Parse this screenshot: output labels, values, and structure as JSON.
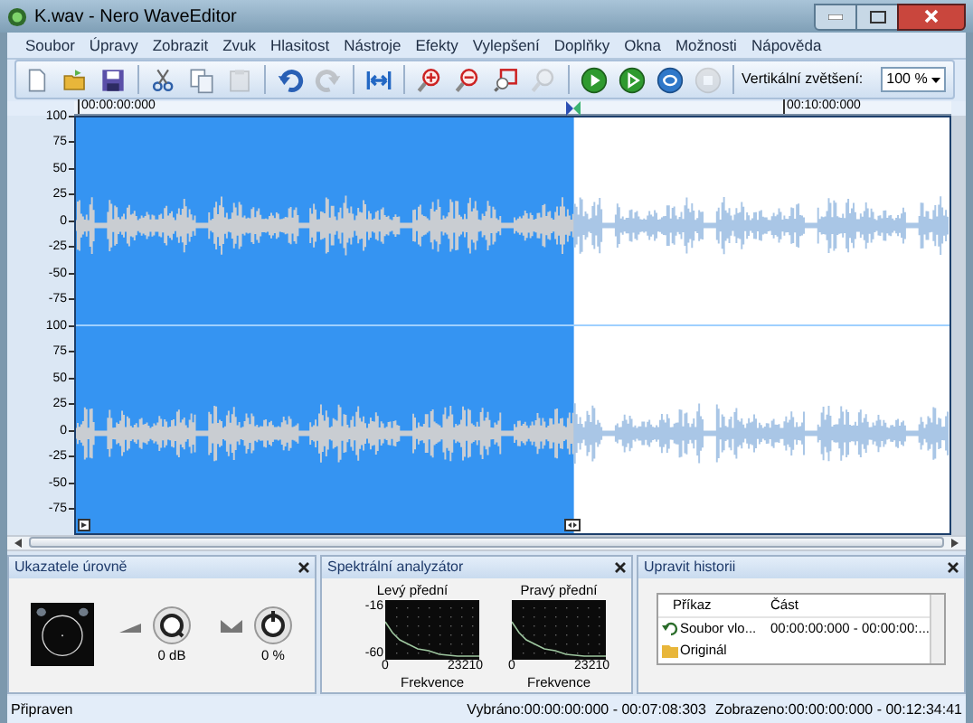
{
  "window": {
    "title": "K.wav - Nero WaveEditor"
  },
  "menu": [
    "Soubor",
    "Úpravy",
    "Zobrazit",
    "Zvuk",
    "Hlasitost",
    "Nástroje",
    "Efekty",
    "Vylepšení",
    "Doplňky",
    "Okna",
    "Možnosti",
    "Nápověda"
  ],
  "toolbar": {
    "groups": [
      [
        {
          "kind": "new",
          "disabled": false
        },
        {
          "kind": "open",
          "disabled": false
        },
        {
          "kind": "save",
          "disabled": false
        }
      ],
      [
        {
          "kind": "cut",
          "disabled": false
        },
        {
          "kind": "copy",
          "disabled": false
        },
        {
          "kind": "paste",
          "disabled": true
        }
      ],
      [
        {
          "kind": "undo",
          "disabled": false
        },
        {
          "kind": "redo",
          "disabled": true
        }
      ],
      [
        {
          "kind": "fit",
          "disabled": false
        }
      ],
      [
        {
          "kind": "zoom-in",
          "disabled": false
        },
        {
          "kind": "zoom-out",
          "disabled": false
        },
        {
          "kind": "zoom-selection",
          "disabled": false
        },
        {
          "kind": "zoom-reset",
          "disabled": true
        }
      ],
      [
        {
          "kind": "play",
          "disabled": false
        },
        {
          "kind": "play-selection",
          "disabled": false
        },
        {
          "kind": "loop",
          "disabled": false
        },
        {
          "kind": "stop",
          "disabled": true
        }
      ]
    ],
    "zoom_label": "Vertikální zvětšení:",
    "zoom_value": "100 %"
  },
  "ruler": {
    "start": "00:00:00:000",
    "mark": "00:10:00:000"
  },
  "channels": [
    {
      "axis_labels": [
        "100",
        "75",
        "50",
        "25",
        "0",
        "-25",
        "-50",
        "-75"
      ]
    },
    {
      "axis_labels": [
        "100",
        "75",
        "50",
        "25",
        "0",
        "-25",
        "-50",
        "-75"
      ]
    }
  ],
  "selection": {
    "level": 0.57
  },
  "panels": {
    "levels": {
      "title": "Ukazatele úrovně",
      "knobs": [
        {
          "kind": "volume",
          "value": "0 dB"
        },
        {
          "kind": "balance",
          "value": "0 %"
        }
      ]
    },
    "spectrum": {
      "title": "Spektrální analyzátor",
      "charts": [
        {
          "name": "Levý přední",
          "yticks": [
            "-16",
            "-60"
          ],
          "xticks": [
            "0",
            "23210"
          ],
          "xlabel": "Frekvence"
        },
        {
          "name": "Pravý přední",
          "xticks": [
            "0",
            "23210"
          ],
          "xlabel": "Frekvence"
        }
      ]
    },
    "history": {
      "title": "Upravit historii",
      "columns": [
        "Příkaz",
        "Část"
      ],
      "rows": [
        {
          "kind": "undo",
          "command": "Soubor vlo...",
          "part": "00:00:00:000 - 00:00:00:..."
        },
        {
          "kind": "folder",
          "command": "Originál",
          "part": ""
        }
      ]
    }
  },
  "status_bar": {
    "state": "Připraven",
    "selected": "Vybráno:00:00:00:000 - 00:07:08:303",
    "shown": "Zobrazeno:00:00:00:000 - 00:12:34:41"
  }
}
